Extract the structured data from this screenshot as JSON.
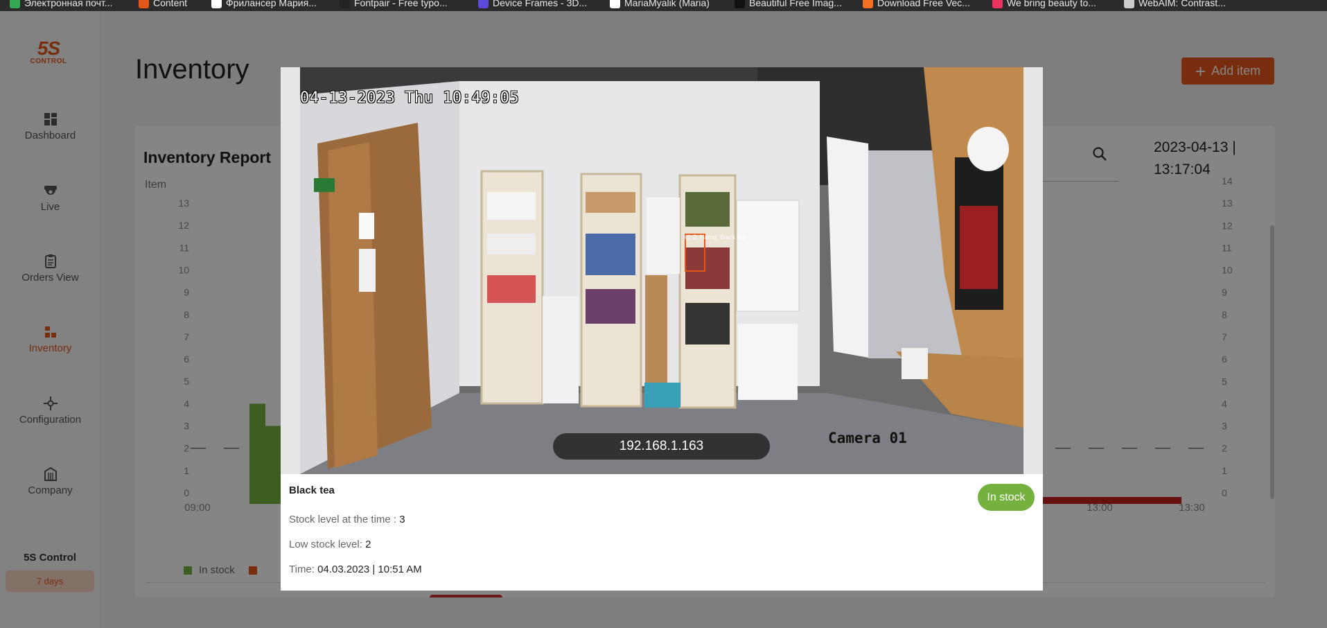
{
  "bookmarks": [
    {
      "label": "Электронная почт...",
      "icon": "google-icon",
      "color": "#34a853"
    },
    {
      "label": "Content",
      "icon": "pen-icon",
      "color": "#e4571b"
    },
    {
      "label": "Фрилансер Мария...",
      "icon": "k-icon",
      "color": "#ffffff"
    },
    {
      "label": "Fontpair - Free typo...",
      "icon": "fp-icon",
      "color": "#222222"
    },
    {
      "label": "Device Frames - 3D...",
      "icon": "df-icon",
      "color": "#5b4bdb"
    },
    {
      "label": "MariaMyalik (Maria)",
      "icon": "github-icon",
      "color": "#ffffff"
    },
    {
      "label": "Beautiful Free Imag...",
      "icon": "unsplash-icon",
      "color": "#111111"
    },
    {
      "label": "Download Free Vec...",
      "icon": "freepik-icon",
      "color": "#f36f21"
    },
    {
      "label": "We bring beauty to...",
      "icon": "dribbble-icon",
      "color": "#e93460"
    },
    {
      "label": "WebAIM: Contrast...",
      "icon": "webaim-icon",
      "color": "#cccccc"
    }
  ],
  "sidebar": {
    "logo_big": "5S",
    "logo_small": "CONTROL",
    "items": [
      {
        "label": "Dashboard",
        "icon": "dashboard-icon"
      },
      {
        "label": "Live",
        "icon": "camera-icon"
      },
      {
        "label": "Orders View",
        "icon": "clipboard-icon"
      },
      {
        "label": "Inventory",
        "icon": "inventory-icon",
        "active": true
      },
      {
        "label": "Configuration",
        "icon": "configuration-icon"
      },
      {
        "label": "Company",
        "icon": "company-icon"
      }
    ],
    "footer_brand": "5S Control",
    "footer_plan": "7 days"
  },
  "page": {
    "title": "Inventory",
    "add_button": "Add item"
  },
  "report": {
    "title": "Inventory Report",
    "y_label": "Item",
    "date": "2023-04-13 |",
    "time": "13:17:04",
    "legend": [
      {
        "label": "In stock",
        "color": "#74b13e"
      },
      {
        "label": "",
        "color": "#e4571b"
      }
    ]
  },
  "chart_data": {
    "type": "bar",
    "y_ticks": [
      0,
      1,
      2,
      3,
      4,
      5,
      6,
      7,
      8,
      9,
      10,
      11,
      12,
      13
    ],
    "y_ticks_right": [
      0,
      1,
      2,
      3,
      4,
      5,
      6,
      7,
      8,
      9,
      10,
      11,
      12,
      13,
      14
    ],
    "x_ticks": [
      "09:00",
      "13:00",
      "13:30"
    ],
    "ylim": [
      0,
      13
    ],
    "low_stock_level": 2,
    "series": [
      {
        "name": "In stock",
        "color": "#74b13e",
        "values": [
          4,
          3
        ]
      }
    ]
  },
  "modal": {
    "camera_timestamp": "04-13-2023 Thu 10:49:05",
    "camera_name": "Camera 01",
    "camera_ip": "192.168.1.163",
    "detection_label": "id: 2, Name: Black tea",
    "item_name": "Black tea",
    "status": "In stock",
    "status_color": "#74b13e",
    "stock_label": "Stock level at the time :",
    "stock_value": "3",
    "low_label": "Low stock level:",
    "low_value": "2",
    "time_label": "Time:",
    "time_value": "04.03.2023 | 10:51 AM"
  }
}
